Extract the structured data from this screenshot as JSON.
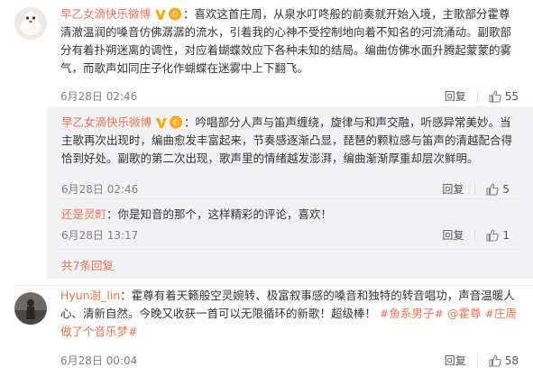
{
  "comments": [
    {
      "user": "早乙女滴快乐微博",
      "text": "：喜欢这首庄周，从泉水叮咚般的前奏就开始入境，主歌部分霍尊清澈温润的嗓音仿佛潺潺的流水，引着我的心神不受控制地向着不知名的河流涌动。副歌部分有着扑朔迷离的调性，对应着蝴蝶效应下各种未知的结局。编曲仿佛水面升腾起蒙蒙的雾气，而歌声如同庄子化作蝴蝶在迷雾中上下翻飞。",
      "time": "6月28日 02:46",
      "reply_label": "回复",
      "likes": "55"
    },
    {
      "user": "Hyun澍_lin",
      "text": "：霍尊有着天籁般空灵婉转、极富叙事感的嗓音和独特的转音唱功，声音温暖人心、清新自然。今晚又收获一首可以无限循环的新歌！超级棒！",
      "hashtags": [
        "#鱼系男子#",
        "@霍尊",
        "#庄周做了个音乐梦#"
      ],
      "time": "6月28日 00:04",
      "reply_label": "回复",
      "likes": "58"
    }
  ],
  "replies": [
    {
      "user": "早乙女滴快乐微博",
      "text": "：吟唱部分人声与笛声缠绕，旋律与和声交融，听感异常美妙。当主歌再次出现时，编曲愈发丰富起来，节奏感逐渐凸显，琵琶的颗粒感与笛声的清越配合得恰到好处。副歌的第二次出现，歌声里的情绪越发澎湃，编曲渐渐厚重却层次鲜明。",
      "time": "6月28日 02:46",
      "reply_label": "回复",
      "likes": "5"
    },
    {
      "user": "还是灵町",
      "text": "：你是知音的那个，这样精彩的评论，喜欢！",
      "time": "6月28日 13:17",
      "reply_label": "回复",
      "likes": "1"
    }
  ],
  "more_replies": "共7条回复",
  "colors": {
    "accent": "#eb7350",
    "vip": "#f7ab00",
    "reply_bg": "#f2f2f5"
  }
}
